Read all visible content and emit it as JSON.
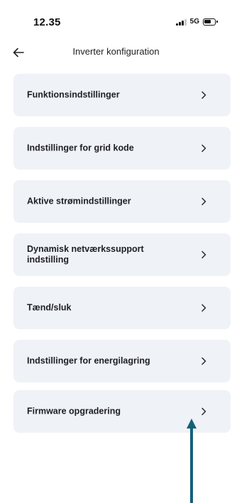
{
  "status_bar": {
    "time": "12.35",
    "network": "5G",
    "icons": [
      "signal-icon",
      "battery-icon"
    ]
  },
  "header": {
    "title": "Inverter konfiguration",
    "back_icon": "arrow-left-icon"
  },
  "menu": {
    "items": [
      {
        "label": "Funktionsindstillinger"
      },
      {
        "label": "Indstillinger for grid kode"
      },
      {
        "label": "Aktive strømindstillinger"
      },
      {
        "label": "Dynamisk netværkssupport indstilling"
      },
      {
        "label": "Tænd/sluk"
      },
      {
        "label": "Indstillinger for energilagring"
      },
      {
        "label": "Firmware opgradering"
      }
    ],
    "chevron_icon": "chevron-right-icon"
  },
  "annotation": {
    "icon": "arrow-up-icon",
    "color": "#15607a",
    "points_to": "Firmware opgradering"
  },
  "colors": {
    "card_background": "#eff2f6",
    "text": "#1e1e24"
  }
}
